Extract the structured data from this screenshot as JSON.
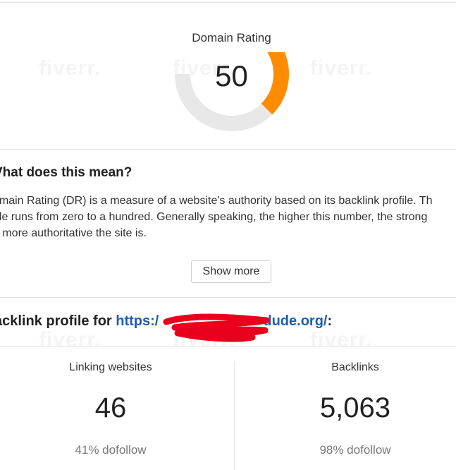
{
  "domain_rating": {
    "title": "Domain Rating",
    "value": "50",
    "fraction": 0.5,
    "colors": {
      "accent": "#ff8c00",
      "track": "#e8e8e8"
    }
  },
  "meaning": {
    "heading": "Vhat does this mean?",
    "lines": [
      "omain Rating (DR) is a measure of a website's authority based on its backlink profile. Th",
      "ale runs from zero to a hundred. Generally speaking, the higher this number, the strong",
      "d more authoritative the site is."
    ],
    "show_more_label": "Show more"
  },
  "backlink_profile": {
    "heading_prefix": "acklink profile for ",
    "url_start": "https:/",
    "url_end": "dude.org/",
    "heading_suffix": ":"
  },
  "stats": [
    {
      "label": "Linking websites",
      "value": "46",
      "sub": "41% dofollow"
    },
    {
      "label": "Backlinks",
      "value": "5,063",
      "sub": "98% dofollow"
    }
  ],
  "watermark": "fiverr."
}
